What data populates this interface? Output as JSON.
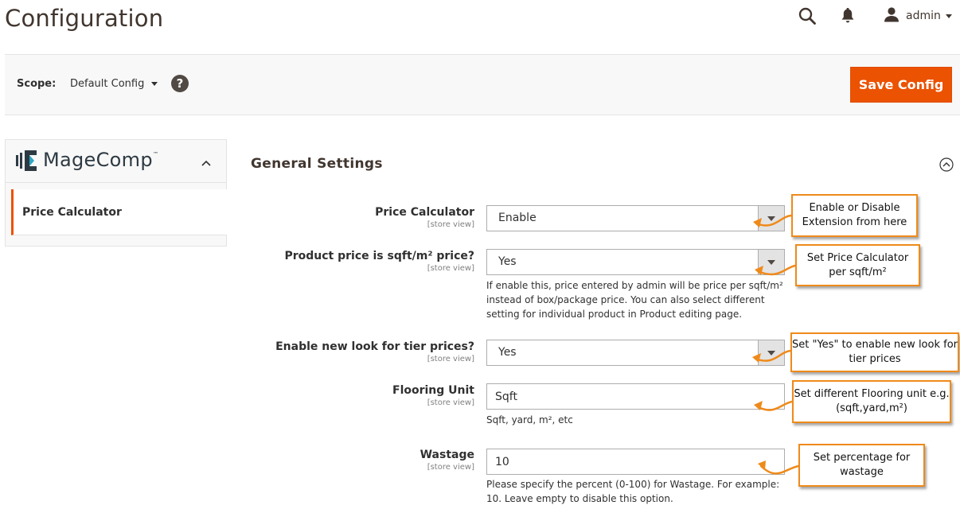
{
  "page": {
    "title": "Configuration"
  },
  "header": {
    "user_name": "admin"
  },
  "scope_bar": {
    "label": "Scope:",
    "value": "Default Config",
    "help": "?",
    "save_label": "Save Config"
  },
  "sidebar": {
    "brand": "MageComp",
    "brand_tm": "™",
    "item_label": "Price Calculator"
  },
  "section": {
    "title": "General Settings"
  },
  "fields": [
    {
      "label": "Price Calculator",
      "scope": "[store view]",
      "value": "Enable"
    },
    {
      "label": "Product price is sqft/m² price?",
      "scope": "[store view]",
      "value": "Yes",
      "note": "If enable this, price entered by admin will be price per sqft/m² instead of box/package price. You can also select different setting for individual product in Product editing page."
    },
    {
      "label": "Enable new look for tier prices?",
      "scope": "[store view]",
      "value": "Yes"
    },
    {
      "label": "Flooring Unit",
      "scope": "[store view]",
      "value": "Sqft",
      "note": "Sqft, yard, m², etc"
    },
    {
      "label": "Wastage",
      "scope": "[store view]",
      "value": "10",
      "note": "Please specify the percent (0-100) for Wastage. For example: 10. Leave empty to disable this option."
    }
  ],
  "callouts": [
    "Enable or Disable Extension from here",
    "Set Price Calculator per sqft/m²",
    "Set \"Yes\" to enable new look for tier prices",
    "Set different Flooring unit e.g.(sqft,yard,m²)",
    "Set percentage for wastage"
  ],
  "colors": {
    "accent": "#eb5202",
    "callout_border": "#ef8a1a",
    "text": "#303030"
  }
}
